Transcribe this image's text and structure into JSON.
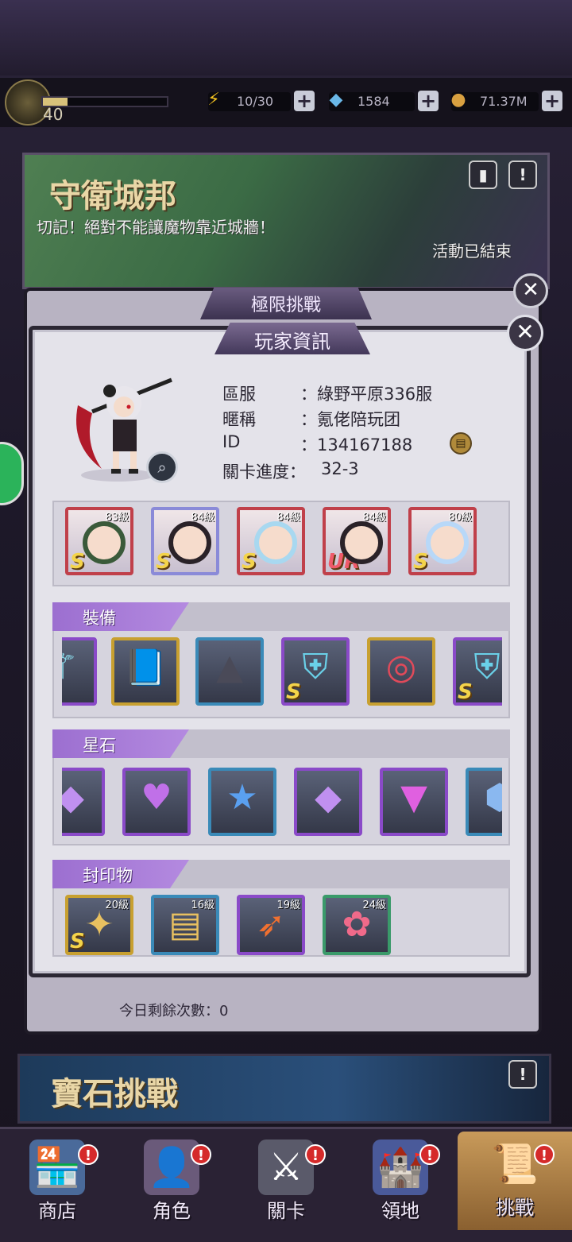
{
  "topbar": {
    "level": "40",
    "xp_fraction": 0.2,
    "energy": "10/30",
    "gems": "1584",
    "gold": "71.37M"
  },
  "banner": {
    "title": "守衛城邦",
    "subtitle": "切記！絕對不能讓魔物靠近城牆！",
    "status": "活動已結束"
  },
  "outer_panel": {
    "title": "極限挑戰",
    "remaining": "今日剩餘次數：0"
  },
  "gem_banner": {
    "title": "寶石挑戰"
  },
  "dialog": {
    "title": "玩家資訊",
    "info_labels": {
      "server": "區服",
      "nickname": "暱稱",
      "id": "ID",
      "progress": "關卡進度："
    },
    "info_values": {
      "server": "：綠野平原336服",
      "nickname": "：氪佬陪玩团",
      "id": "：134167188",
      "progress": "32-3"
    },
    "heroes": [
      {
        "level": "83級",
        "rank": "S",
        "frame": "#c0404a"
      },
      {
        "level": "84級",
        "rank": "S",
        "frame": "#8a8ad8"
      },
      {
        "level": "84級",
        "rank": "S",
        "frame": "#c0404a"
      },
      {
        "level": "84級",
        "rank": "UR",
        "frame": "#c0404a"
      },
      {
        "level": "80級",
        "rank": "S",
        "frame": "#c0404a"
      }
    ],
    "sections": {
      "equipment": "裝備",
      "starstone": "星石",
      "seal": "封印物"
    },
    "equipment": [
      {
        "icon": "staff-icon",
        "frame": "#8a4ac8"
      },
      {
        "icon": "spellbook-icon",
        "frame": "#c8a030"
      },
      {
        "icon": "witch-hat-icon",
        "frame": "#3a8ab8"
      },
      {
        "icon": "armor-icon",
        "frame": "#8a4ac8",
        "rank": "S"
      },
      {
        "icon": "ring-icon",
        "frame": "#c8a030"
      },
      {
        "icon": "armor-icon",
        "frame": "#8a4ac8",
        "rank": "S"
      }
    ],
    "starstones": [
      {
        "icon": "crystal-icon",
        "frame": "#8a4ac8"
      },
      {
        "icon": "heart-gem-icon",
        "frame": "#8a4ac8"
      },
      {
        "icon": "star-gem-icon",
        "frame": "#3a8ab8"
      },
      {
        "icon": "crystal-icon",
        "frame": "#8a4ac8"
      },
      {
        "icon": "triangle-gem-icon",
        "frame": "#8a4ac8"
      },
      {
        "icon": "blue-gem-icon",
        "frame": "#3a8ab8"
      }
    ],
    "seals": [
      {
        "level": "20級",
        "icon": "puppet-icon",
        "frame": "#c8a030",
        "rank": "S"
      },
      {
        "level": "16級",
        "icon": "golden-book-icon",
        "frame": "#3a8ab8"
      },
      {
        "level": "19級",
        "icon": "flame-spear-icon",
        "frame": "#8a4ac8"
      },
      {
        "level": "24級",
        "icon": "flower-icon",
        "frame": "#3a9a6a"
      }
    ]
  },
  "nav": {
    "shop": "商店",
    "character": "角色",
    "stage": "關卡",
    "territory": "領地",
    "challenge": "挑戰",
    "badge": "!"
  }
}
